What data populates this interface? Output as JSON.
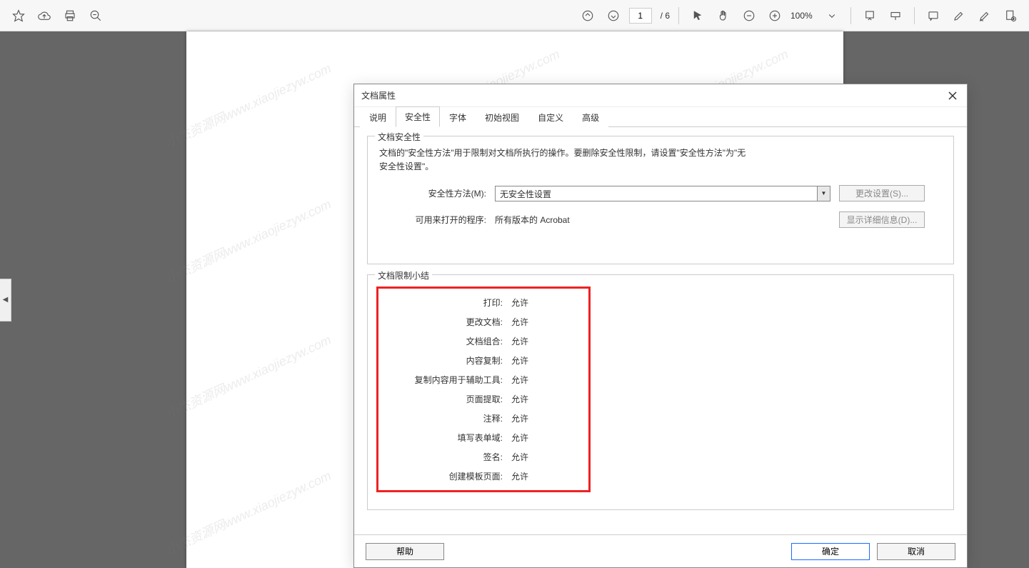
{
  "toolbar": {
    "page_current": "1",
    "page_total": "/ 6",
    "zoom": "100%"
  },
  "watermark": "小杰资源网www.xiaojiezyw.com",
  "dialog": {
    "title": "文档属性",
    "tabs": [
      "说明",
      "安全性",
      "字体",
      "初始视图",
      "自定义",
      "高级"
    ],
    "active_tab_index": 1,
    "security": {
      "section_title": "文档安全性",
      "description": "文档的\"安全性方法\"用于限制对文档所执行的操作。要删除安全性限制，请设置\"安全性方法\"为\"无安全性设置\"。",
      "method_label": "安全性方法(M):",
      "method_value": "无安全性设置",
      "change_settings_btn": "更改设置(S)...",
      "open_with_label": "可用来打开的程序:",
      "open_with_value": "所有版本的 Acrobat",
      "show_details_btn": "显示详细信息(D)..."
    },
    "restrictions": {
      "section_title": "文档限制小结",
      "items": [
        {
          "label": "打印:",
          "value": "允许"
        },
        {
          "label": "更改文档:",
          "value": "允许"
        },
        {
          "label": "文档组合:",
          "value": "允许"
        },
        {
          "label": "内容复制:",
          "value": "允许"
        },
        {
          "label": "复制内容用于辅助工具:",
          "value": "允许"
        },
        {
          "label": "页面提取:",
          "value": "允许"
        },
        {
          "label": "注释:",
          "value": "允许"
        },
        {
          "label": "填写表单域:",
          "value": "允许"
        },
        {
          "label": "签名:",
          "value": "允许"
        },
        {
          "label": "创建模板页面:",
          "value": "允许"
        }
      ]
    },
    "footer": {
      "help": "帮助",
      "ok": "确定",
      "cancel": "取消"
    }
  }
}
